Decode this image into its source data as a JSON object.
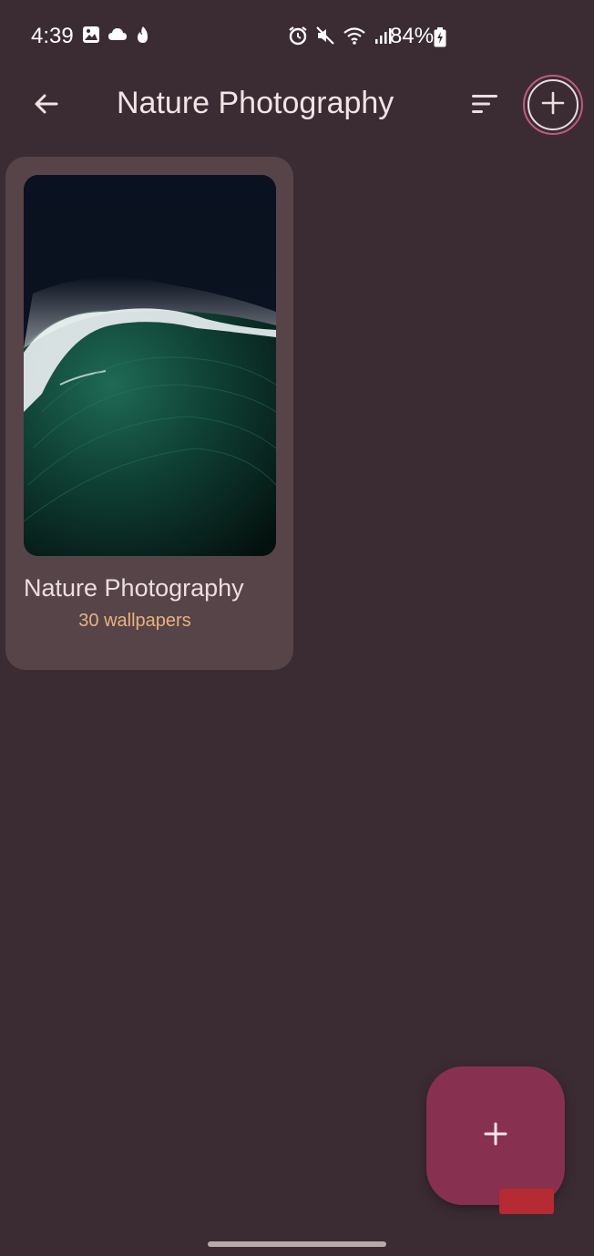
{
  "status_bar": {
    "time": "4:39",
    "battery": "84%",
    "left_icons": [
      "gallery-icon",
      "cloud-icon",
      "tinder-icon"
    ],
    "right_icons": [
      "alarm-icon",
      "mute-icon",
      "wifi-icon",
      "signal-icon",
      "battery-charging-icon"
    ]
  },
  "app_bar": {
    "title": "Nature Photography",
    "back_icon": "arrow-left-icon",
    "sort_icon": "sort-icon",
    "add_icon": "plus-icon"
  },
  "album": {
    "title": "Nature Photography",
    "count": "30 wallpapers",
    "thumbnail": "ocean-wave-image"
  },
  "fab": {
    "icon": "plus-icon"
  },
  "colors": {
    "background": "#3b2c33",
    "card": "#564448",
    "accent": "#88304f",
    "count_text": "#e8b27f",
    "highlight_ring": "#c25a7b"
  }
}
